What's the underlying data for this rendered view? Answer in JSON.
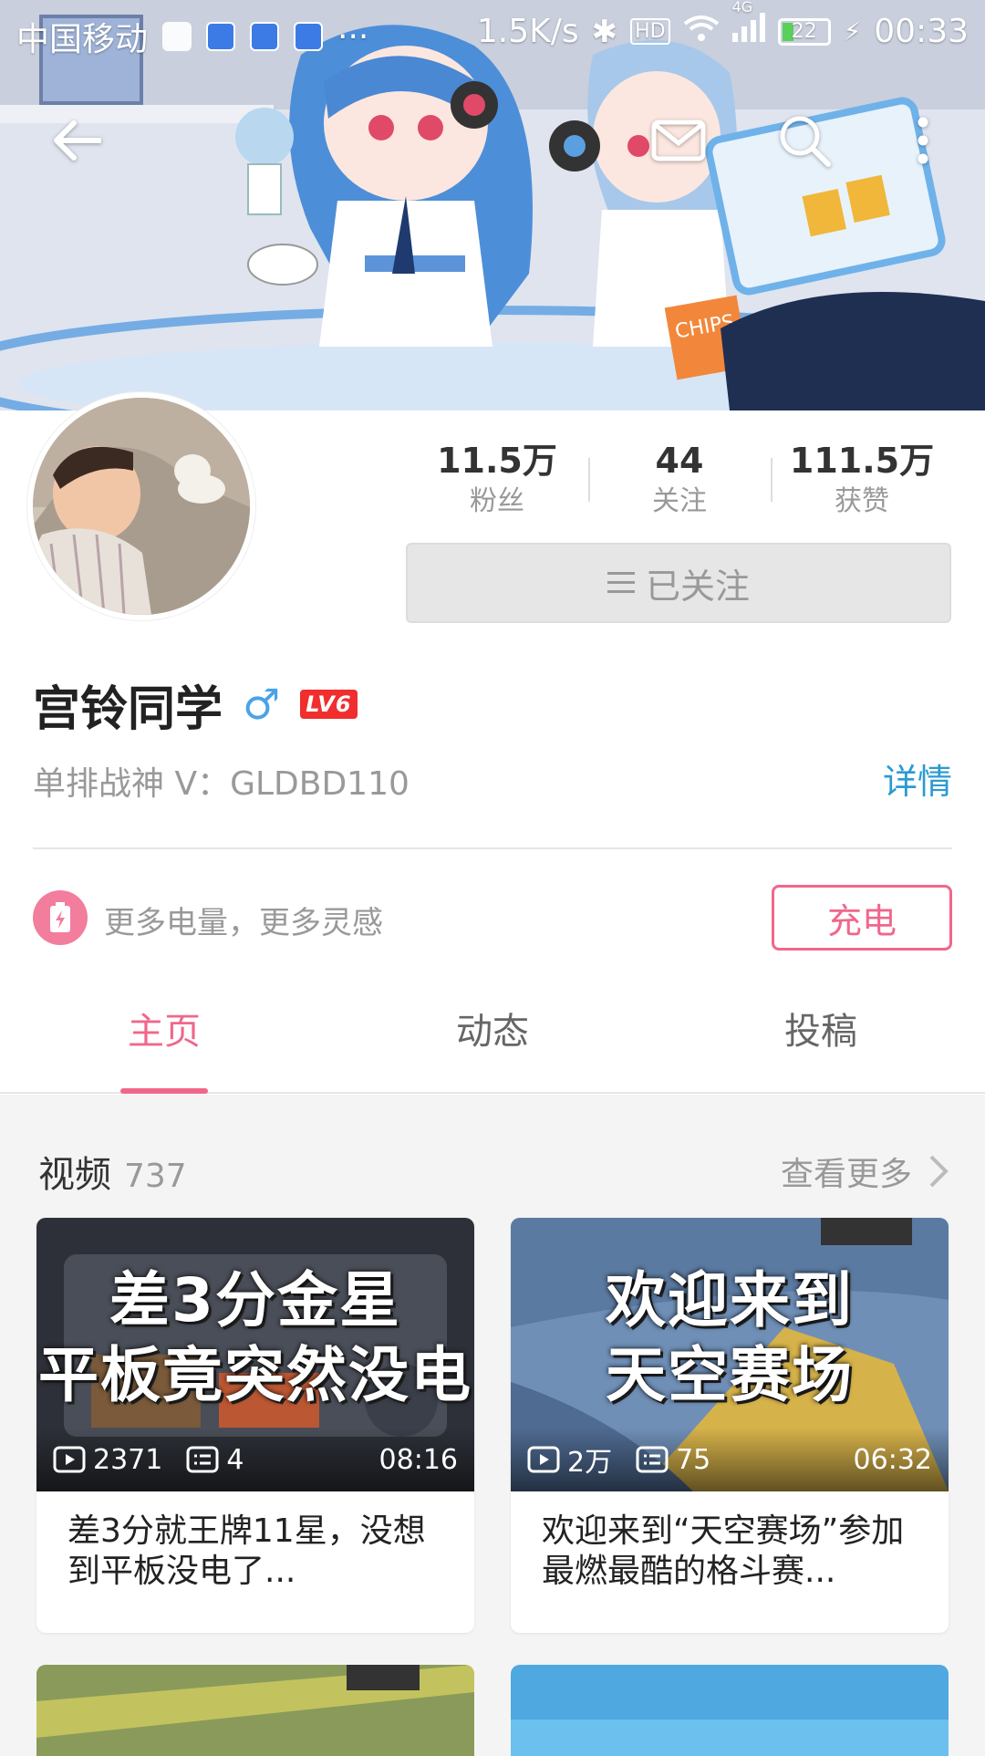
{
  "status_bar": {
    "carrier": "中国移动",
    "speed": "1.5K/s",
    "hd": "HD",
    "net": "4G",
    "battery": "22",
    "time": "00:33"
  },
  "profile": {
    "stats": [
      {
        "value": "11.5万",
        "label": "粉丝"
      },
      {
        "value": "44",
        "label": "关注"
      },
      {
        "value": "111.5万",
        "label": "获赞"
      }
    ],
    "follow_label": "已关注",
    "name": "宫铃同学",
    "gender_symbol": "♂",
    "level": "LV6",
    "signature": "单排战神 V：GLDBD110",
    "detail_link": "详情",
    "charge_text": "更多电量，更多灵感",
    "charge_button": "充电"
  },
  "tabs": [
    {
      "label": "主页",
      "active": true
    },
    {
      "label": "动态",
      "active": false
    },
    {
      "label": "投稿",
      "active": false
    }
  ],
  "videos": {
    "section_title": "视频",
    "count": "737",
    "more_label": "查看更多",
    "items": [
      {
        "thumb_line1": "差3分金星",
        "thumb_line2": "平板竟突然没电",
        "plays": "2371",
        "danmaku": "4",
        "duration": "08:16",
        "title": "差3分就王牌11星，没想到平板没电了..."
      },
      {
        "thumb_line1": "欢迎来到",
        "thumb_line2": "天空赛场",
        "plays": "2万",
        "danmaku": "75",
        "duration": "06:32",
        "title": "欢迎来到“天空赛场”参加最燃最酷的格斗赛..."
      }
    ]
  },
  "colors": {
    "accent_pink": "#f0678b",
    "link_blue": "#2b9bd1",
    "level_red": "#f02e2e"
  }
}
